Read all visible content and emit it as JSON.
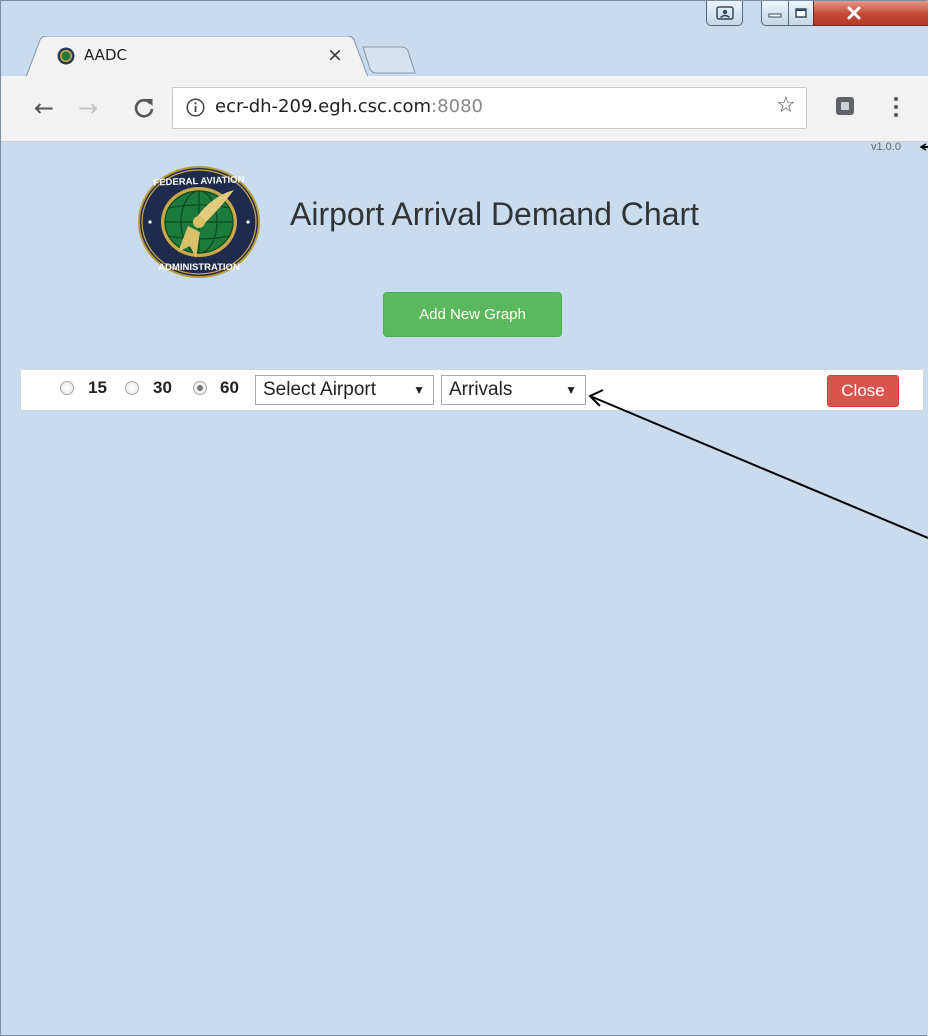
{
  "browser": {
    "tab_title": "AADC",
    "tab_close": "×",
    "url_host": "ecr-dh-209.egh.csc.com",
    "url_port": ":8080"
  },
  "page": {
    "version": "v1.0.0",
    "title": "Airport Arrival Demand Chart",
    "add_button": "Add New Graph"
  },
  "controls": {
    "intervals": [
      {
        "label": "15",
        "checked": false
      },
      {
        "label": "30",
        "checked": false
      },
      {
        "label": "60",
        "checked": true
      }
    ],
    "airport_select": "Select Airport",
    "type_select": "Arrivals",
    "close_button": "Close"
  },
  "icons": {
    "back": "arrow-left-icon",
    "forward": "arrow-right-icon",
    "reload": "reload-icon",
    "info": "info-icon",
    "bookmark": "star-icon",
    "extension": "extension-icon",
    "menu": "menu-dots-icon",
    "logo": "faa-seal-logo"
  },
  "colors": {
    "add_button": "#5cb85c",
    "close_button": "#d9534f",
    "window_close": "#c24a35"
  }
}
